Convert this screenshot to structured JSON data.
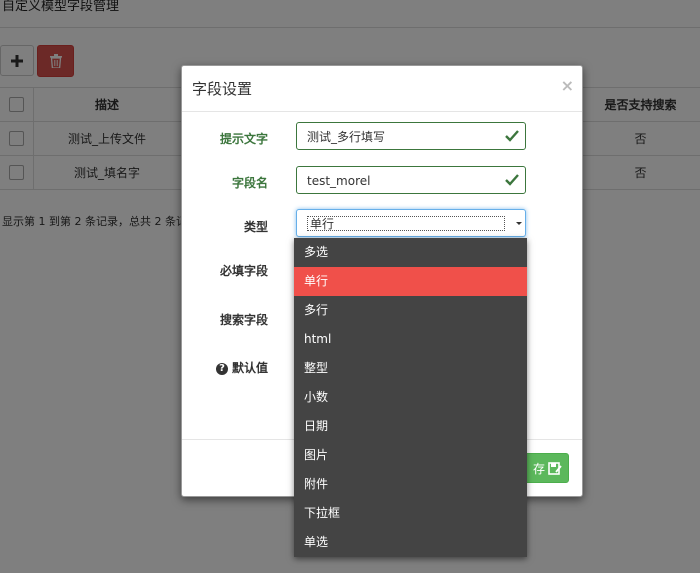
{
  "page": {
    "title": "自定义模型字段管理"
  },
  "toolbar": {
    "add_icon": "plus-icon",
    "delete_icon": "trash-icon"
  },
  "table": {
    "columns": [
      "描述",
      "是否支持搜索"
    ],
    "rows": [
      {
        "desc": "测试_上传文件",
        "searchable": "否"
      },
      {
        "desc": "测试_填名字",
        "searchable": "否"
      }
    ],
    "pager_text": "显示第 1 到第 2 条记录，总共 2 条记"
  },
  "modal": {
    "title": "字段设置",
    "close_label": "×",
    "fields": {
      "hint_label": "提示文字",
      "hint_value": "测试_多行填写",
      "name_label": "字段名",
      "name_value": "test_morel",
      "type_label": "类型",
      "type_value": "单行",
      "required_label": "必填字段",
      "search_label": "搜索字段",
      "default_label": "默认值"
    },
    "save_label": "存"
  },
  "dropdown": {
    "options": [
      "多选",
      "单行",
      "多行",
      "html",
      "整型",
      "小数",
      "日期",
      "图片",
      "附件",
      "下拉框",
      "单选"
    ],
    "selected_index": 1
  },
  "colors": {
    "success": "#3c763d",
    "danger": "#d9534f",
    "selected": "#f0504a",
    "save": "#5cb85c"
  }
}
